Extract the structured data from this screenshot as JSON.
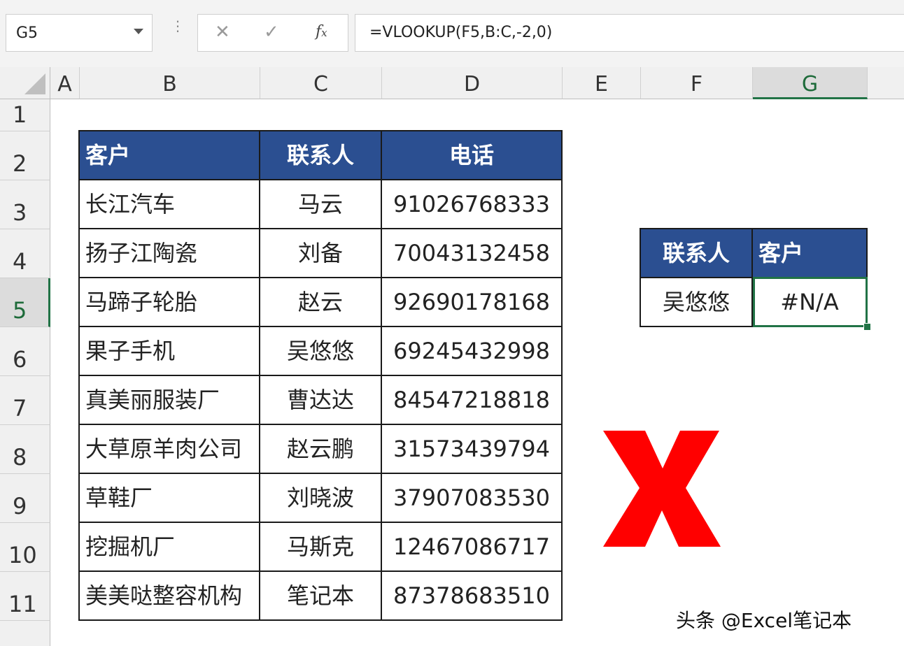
{
  "name_box": "G5",
  "formula_bar": {
    "cancel_icon": "close-icon",
    "enter_icon": "check-icon",
    "fx_label": "fx",
    "formula": "=VLOOKUP(F5,B:C,-2,0)"
  },
  "columns": [
    "A",
    "B",
    "C",
    "D",
    "E",
    "F",
    "G"
  ],
  "rows": [
    "1",
    "2",
    "3",
    "4",
    "5",
    "6",
    "7",
    "8",
    "9",
    "10",
    "11"
  ],
  "selected_cell": {
    "column": "G",
    "row": "5"
  },
  "main_table": {
    "headers": [
      "客户",
      "联系人",
      "电话"
    ],
    "rows": [
      [
        "长江汽车",
        "马云",
        "91026768333"
      ],
      [
        "扬子江陶瓷",
        "刘备",
        "70043132458"
      ],
      [
        "马蹄子轮胎",
        "赵云",
        "92690178168"
      ],
      [
        "果子手机",
        "吴悠悠",
        "69245432998"
      ],
      [
        "真美丽服装厂",
        "曹达达",
        "84547218818"
      ],
      [
        "大草原羊肉公司",
        "赵云鹏",
        "31573439794"
      ],
      [
        "草鞋厂",
        "刘晓波",
        "37907083530"
      ],
      [
        "挖掘机厂",
        "马斯克",
        "12467086717"
      ],
      [
        "美美哒整容机构",
        "笔记本",
        "87378683510"
      ]
    ]
  },
  "lookup_table": {
    "headers": [
      "联系人",
      "客户"
    ],
    "values": [
      "吴悠悠",
      "#N/A"
    ]
  },
  "annotation": {
    "icon": "red-x-icon",
    "color": "#ff0000"
  },
  "watermark": "头条 @Excel笔记本",
  "colors": {
    "header_fill": "#2b4f91",
    "selection": "#217346",
    "error_mark": "#ff0000"
  }
}
